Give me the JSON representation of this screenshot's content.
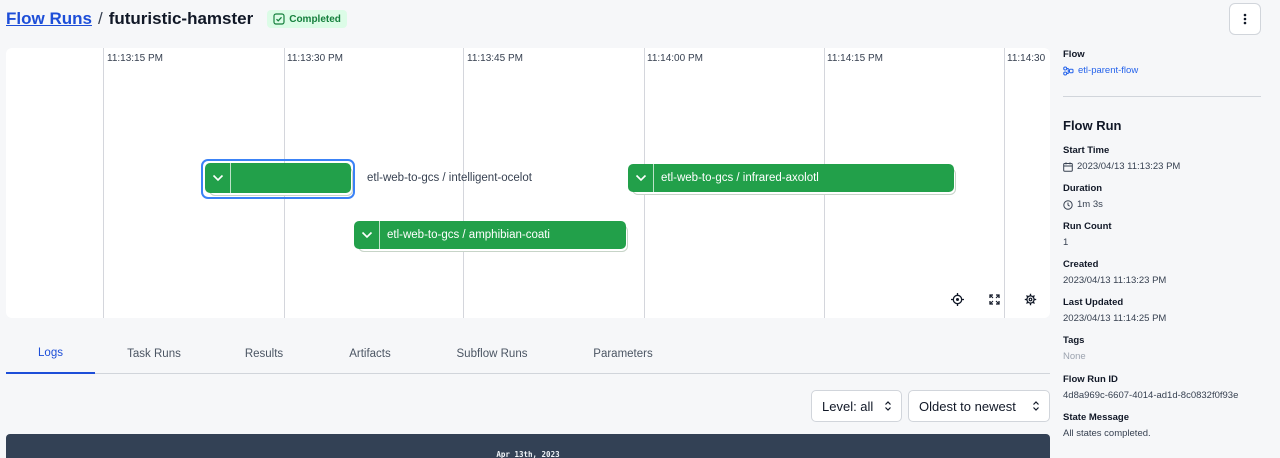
{
  "breadcrumb": {
    "root": "Flow Runs",
    "separator": "/",
    "current": "futuristic-hamster"
  },
  "state_badge": {
    "label": "Completed",
    "color": "#22a04a"
  },
  "menu_icon": "more-vertical-icon",
  "timeline": {
    "ticks": [
      "11:13:15 PM",
      "11:13:30 PM",
      "11:13:45 PM",
      "11:14:00 PM",
      "11:14:15 PM",
      "11:14:30"
    ],
    "nodes": {
      "intelligent_ocelot": "etl-web-to-gcs / intelligent-ocelot",
      "infrared_axolotl": "etl-web-to-gcs / infrared-axolotl",
      "amphibian_coati": "etl-web-to-gcs / amphibian-coati"
    },
    "controls": [
      "recenter-icon",
      "fullscreen-icon",
      "settings-icon"
    ]
  },
  "tabs": [
    "Logs",
    "Task Runs",
    "Results",
    "Artifacts",
    "Subflow Runs",
    "Parameters"
  ],
  "active_tab": "Logs",
  "filters": {
    "level": "Level: all",
    "order": "Oldest to newest"
  },
  "logs": {
    "date_header": "Apr 13th, 2023"
  },
  "sidebar": {
    "flow_label": "Flow",
    "flow_value": "etl-parent-flow",
    "section_title": "Flow Run",
    "start_time_label": "Start Time",
    "start_time_value": "2023/04/13 11:13:23 PM",
    "duration_label": "Duration",
    "duration_value": "1m 3s",
    "run_count_label": "Run Count",
    "run_count_value": "1",
    "created_label": "Created",
    "created_value": "2023/04/13 11:13:23 PM",
    "last_updated_label": "Last Updated",
    "last_updated_value": "2023/04/13 11:14:25 PM",
    "tags_label": "Tags",
    "tags_value": "None",
    "flow_run_id_label": "Flow Run ID",
    "flow_run_id_value": "4d8a969c-6607-4014-ad1d-8c0832f0f93e",
    "state_message_label": "State Message",
    "state_message_value": "All states completed."
  }
}
